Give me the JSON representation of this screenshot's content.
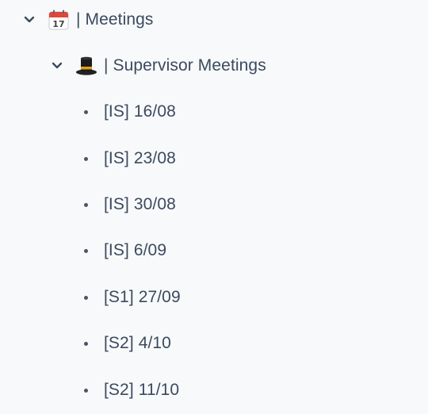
{
  "tree": {
    "root": {
      "icon": "calendar-icon",
      "label": "| Meetings",
      "expanded": true
    },
    "child": {
      "icon": "top-hat-icon",
      "label": "| Supervisor Meetings",
      "expanded": true
    },
    "items": [
      {
        "label": "[IS] 16/08"
      },
      {
        "label": "[IS] 23/08"
      },
      {
        "label": "[IS] 30/08"
      },
      {
        "label": "[IS] 6/09"
      },
      {
        "label": "[S1] 27/09"
      },
      {
        "label": "[S2] 4/10"
      },
      {
        "label": "[S2] 11/10"
      }
    ]
  }
}
